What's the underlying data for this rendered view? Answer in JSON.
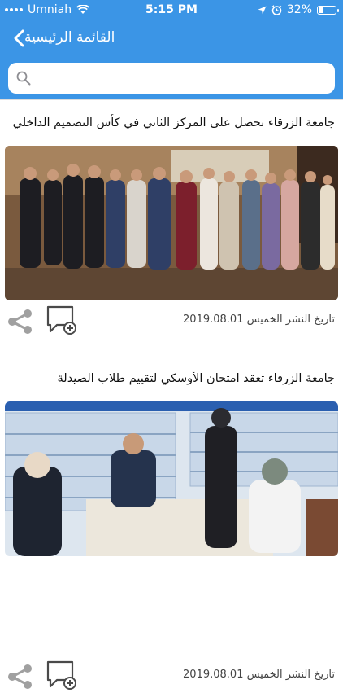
{
  "status": {
    "carrier": "Umniah",
    "time": "5:15 PM",
    "battery": "32%",
    "battery_level": 0.32
  },
  "nav": {
    "title": "القائمة الرئيسية",
    "back_icon": "chevron-left-icon"
  },
  "search": {
    "placeholder": "",
    "value": ""
  },
  "posts": [
    {
      "headline": "جامعة الزرقاء تحصل على المركز الثاني في كأس التصميم الداخلي",
      "date_label": "تاريخ النشر",
      "day": "الخميس",
      "date": "2019.08.01"
    },
    {
      "headline": "جامعة الزرقاء تعقد امتحان الأوسكي لتقييم طلاب الصيدلة",
      "date_label": "تاريخ النشر",
      "day": "الخميس",
      "date": "2019.08.01"
    }
  ],
  "colors": {
    "primary": "#3b95e6",
    "icon_gray": "#9a9a9a"
  }
}
